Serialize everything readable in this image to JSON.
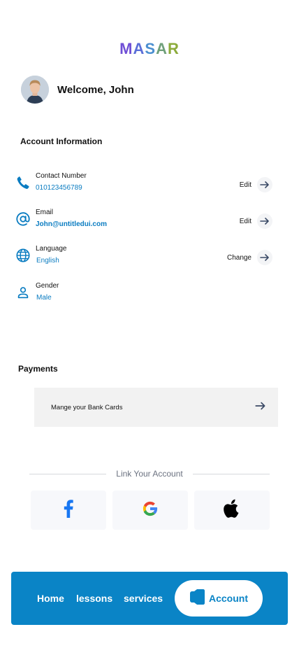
{
  "brand": {
    "logo_letters": [
      "M",
      "A",
      "S",
      "A",
      "R"
    ],
    "logo_colors": [
      "#6f4fd6",
      "#5b6fd8",
      "#4b8fd0",
      "#6fa07a",
      "#8cab3b"
    ]
  },
  "header": {
    "welcome": "Welcome, John"
  },
  "account_info": {
    "title": "Account Information",
    "items": [
      {
        "label": "Contact Number",
        "value": "010123456789",
        "action": "Edit",
        "icon": "phone-icon"
      },
      {
        "label": "Email",
        "value": "John@untitledui.com",
        "action": "Edit",
        "icon": "at-sign-icon"
      },
      {
        "label": "Language",
        "value": "English",
        "action": "Change",
        "icon": "globe-icon"
      },
      {
        "label": "Gender",
        "value": "Male",
        "action": "",
        "icon": "user-icon"
      }
    ]
  },
  "payments": {
    "title": "Payments",
    "bank_cards_label": "Mange your Bank Cards"
  },
  "link_account": {
    "title": "Link Your Account",
    "providers": [
      "facebook-icon",
      "google-icon",
      "apple-icon"
    ]
  },
  "nav": {
    "home": "Home",
    "lessons": "lessons",
    "services": "services",
    "account": "Account"
  },
  "colors": {
    "accent": "#0a84c6",
    "link_blue": "#0a7cc1"
  }
}
